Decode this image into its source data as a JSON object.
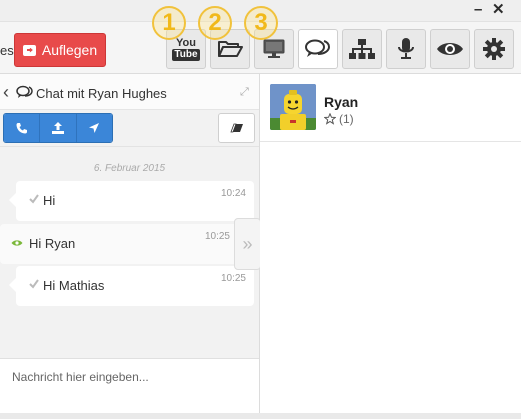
{
  "window": {
    "minimize": "–",
    "close": "✕"
  },
  "toolbar": {
    "left_text": "es",
    "hangup_label": "Auflegen",
    "buttons": [
      {
        "name": "youtube",
        "icon": "youtube-icon",
        "label_top": "You",
        "label_bottom": "Tube"
      },
      {
        "name": "folder",
        "icon": "folder-open-icon"
      },
      {
        "name": "screen",
        "icon": "monitor-icon"
      },
      {
        "name": "chat",
        "icon": "chat-icon",
        "active": true
      },
      {
        "name": "sitemap",
        "icon": "sitemap-icon"
      },
      {
        "name": "microphone",
        "icon": "microphone-icon"
      },
      {
        "name": "eye",
        "icon": "eye-icon"
      },
      {
        "name": "settings",
        "icon": "gear-icon"
      }
    ],
    "badges": [
      "1",
      "2",
      "3"
    ]
  },
  "chat": {
    "title": "Chat mit Ryan Hughes",
    "back": "‹",
    "date": "6. Februar 2015",
    "messages": [
      {
        "text": "Hi",
        "time": "10:24",
        "status": "check-icon"
      },
      {
        "text": "Hi Ryan",
        "time": "10:25",
        "status": "eye-icon"
      },
      {
        "text": "Hi Mathias",
        "time": "10:25",
        "status": "check-icon"
      }
    ],
    "input_placeholder": "Nachricht hier eingeben..."
  },
  "contact": {
    "name": "Ryan",
    "rating": "(1)"
  },
  "colors": {
    "accent_blue": "#3b86d8",
    "hangup_red": "#e84a4a",
    "badge_yellow": "#f1c23c",
    "seen_green": "#7bb83a"
  }
}
